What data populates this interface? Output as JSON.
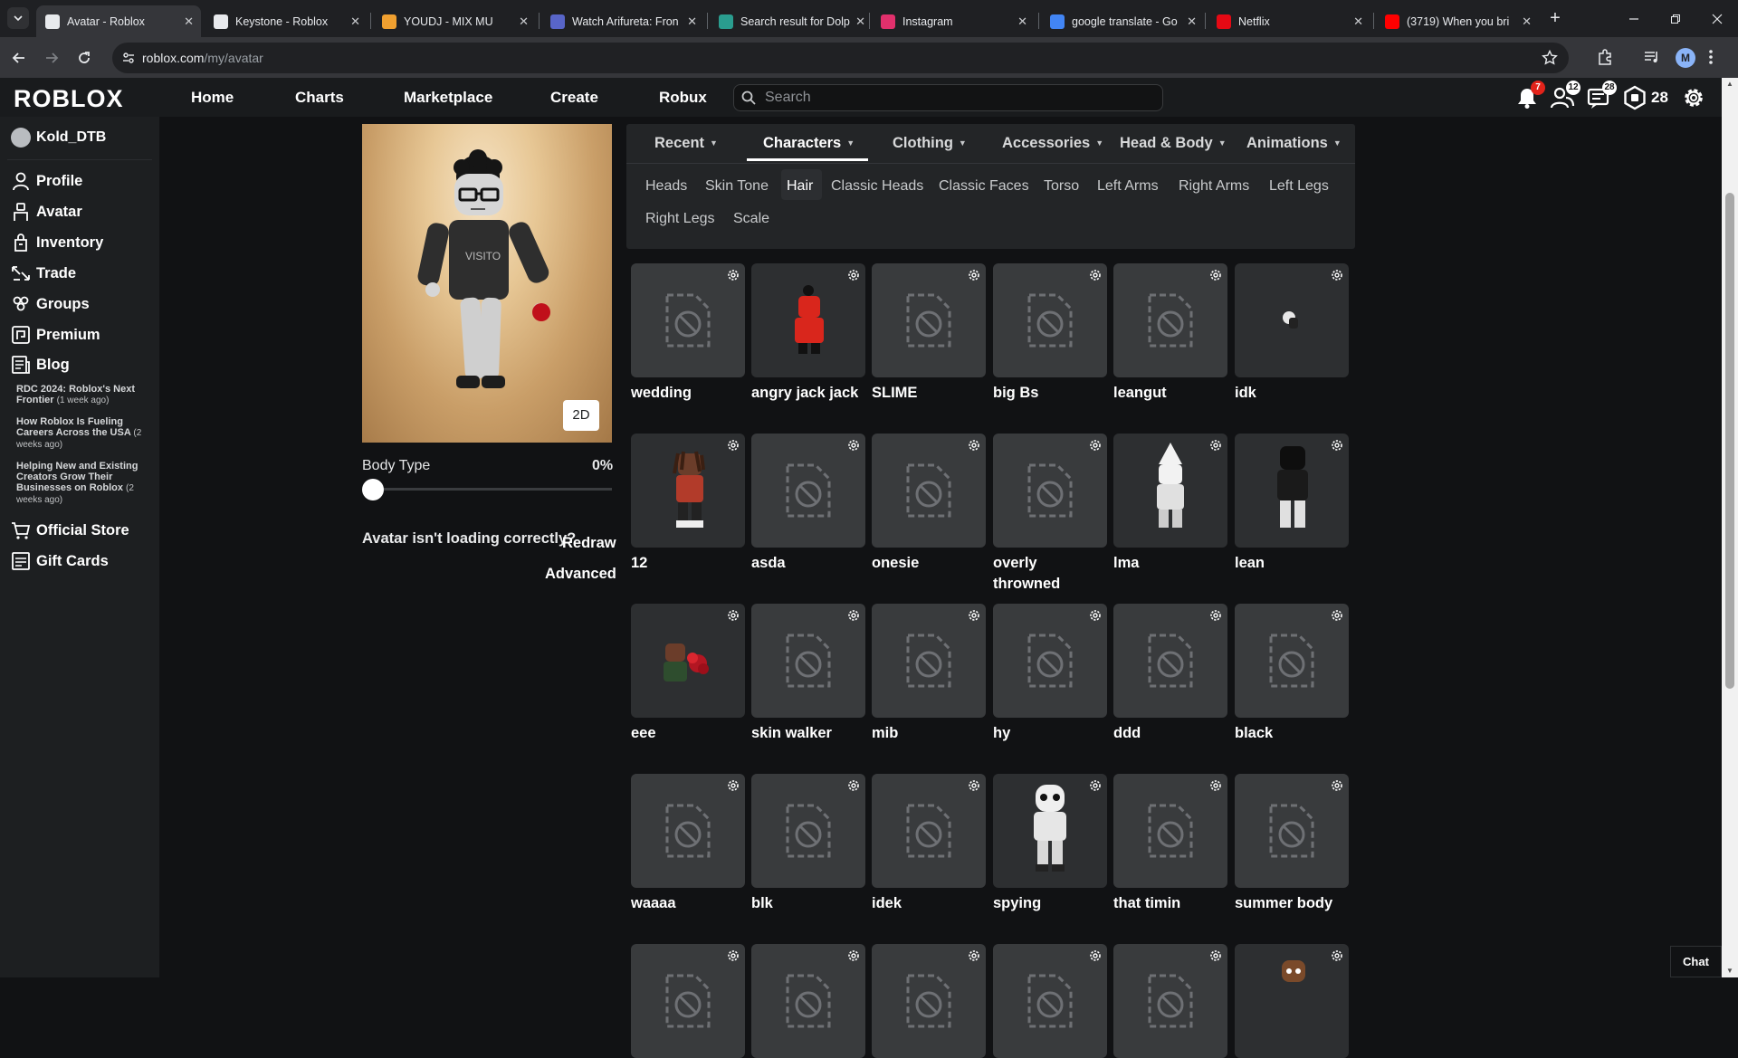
{
  "browser": {
    "tabs": [
      {
        "title": "Avatar - Roblox",
        "active": true,
        "favicon_color": "#e8eaed"
      },
      {
        "title": "Keystone - Roblox",
        "active": false,
        "favicon_color": "#e8eaed"
      },
      {
        "title": "YOUDJ - MIX MU",
        "active": false,
        "favicon_color": "#f0a030"
      },
      {
        "title": "Watch Arifureta: Fron",
        "active": false,
        "favicon_color": "#5865c8"
      },
      {
        "title": "Search result for Dolp",
        "active": false,
        "favicon_color": "#2a9d8f"
      },
      {
        "title": "Instagram",
        "active": false,
        "favicon_color": "#e1306c"
      },
      {
        "title": "google translate - Go",
        "active": false,
        "favicon_color": "#4285f4"
      },
      {
        "title": "Netflix",
        "active": false,
        "favicon_color": "#e50914"
      },
      {
        "title": "(3719) When you bri",
        "active": false,
        "favicon_color": "#ff0000"
      }
    ],
    "url_host": "roblox.com",
    "url_path": "/my/avatar",
    "profile_initial": "M"
  },
  "header": {
    "logo": "ROBLOX",
    "nav": [
      "Home",
      "Charts",
      "Marketplace",
      "Create",
      "Robux"
    ],
    "search_placeholder": "Search",
    "notifications_count": "7",
    "friends_count": "12",
    "messages_count": "28",
    "robux_balance": "28"
  },
  "sidebar": {
    "username": "Kold_DTB",
    "items": [
      {
        "label": "Profile",
        "icon": "profile-icon"
      },
      {
        "label": "Avatar",
        "icon": "avatar-icon"
      },
      {
        "label": "Inventory",
        "icon": "inventory-icon"
      },
      {
        "label": "Trade",
        "icon": "trade-icon"
      },
      {
        "label": "Groups",
        "icon": "groups-icon"
      },
      {
        "label": "Premium",
        "icon": "premium-icon"
      },
      {
        "label": "Blog",
        "icon": "blog-icon"
      }
    ],
    "blog_posts": [
      {
        "title": "RDC 2024: Roblox's Next Frontier",
        "when": "(1 week ago)"
      },
      {
        "title": "How Roblox Is Fueling Careers Across the USA",
        "when": "(2 weeks ago)"
      },
      {
        "title": "Helping New and Existing Creators Grow Their Businesses on Roblox",
        "when": "(2 weeks ago)"
      }
    ],
    "bottom_items": [
      {
        "label": "Official Store",
        "icon": "store-icon"
      },
      {
        "label": "Gift Cards",
        "icon": "gift-card-icon"
      }
    ]
  },
  "preview": {
    "toggle_label": "2D",
    "body_type_label": "Body Type",
    "body_type_value": "0%",
    "body_type_fraction": 0,
    "loading_message": "Avatar isn't loading correctly?",
    "redraw_label": "Redraw",
    "advanced_label": "Advanced"
  },
  "categories": {
    "tabs": [
      "Recent",
      "Characters",
      "Clothing",
      "Accessories",
      "Head & Body",
      "Animations"
    ],
    "active_tab": "Characters",
    "subtabs": [
      "Heads",
      "Skin Tone",
      "Hair",
      "Classic Heads",
      "Classic Faces",
      "Torso",
      "Left Arms",
      "Right Arms",
      "Left Legs",
      "Right Legs",
      "Scale"
    ],
    "active_subtab": "Hair"
  },
  "items": [
    {
      "name": "wedding",
      "thumb": "placeholder"
    },
    {
      "name": "angry jack jack",
      "thumb": "red-character"
    },
    {
      "name": "SLIME",
      "thumb": "placeholder"
    },
    {
      "name": "big Bs",
      "thumb": "placeholder"
    },
    {
      "name": "leangut",
      "thumb": "placeholder"
    },
    {
      "name": "idk",
      "thumb": "small-character"
    },
    {
      "name": "12",
      "thumb": "character-dreads"
    },
    {
      "name": "asda",
      "thumb": "placeholder"
    },
    {
      "name": "onesie",
      "thumb": "placeholder"
    },
    {
      "name": "overly throwned",
      "thumb": "placeholder"
    },
    {
      "name": "lma",
      "thumb": "white-hat-character"
    },
    {
      "name": "lean",
      "thumb": "dark-character"
    },
    {
      "name": "eee",
      "thumb": "character-roses"
    },
    {
      "name": "skin walker",
      "thumb": "placeholder"
    },
    {
      "name": "mib",
      "thumb": "placeholder"
    },
    {
      "name": "hy",
      "thumb": "placeholder"
    },
    {
      "name": "ddd",
      "thumb": "placeholder"
    },
    {
      "name": "black",
      "thumb": "placeholder"
    },
    {
      "name": "waaaa",
      "thumb": "placeholder"
    },
    {
      "name": "blk",
      "thumb": "placeholder"
    },
    {
      "name": "idek",
      "thumb": "placeholder"
    },
    {
      "name": "spying",
      "thumb": "mask-character"
    },
    {
      "name": "that timin",
      "thumb": "placeholder"
    },
    {
      "name": "summer body",
      "thumb": "placeholder"
    },
    {
      "name": "",
      "thumb": "placeholder"
    },
    {
      "name": "",
      "thumb": "placeholder"
    },
    {
      "name": "",
      "thumb": "placeholder"
    },
    {
      "name": "",
      "thumb": "placeholder"
    },
    {
      "name": "",
      "thumb": "placeholder"
    },
    {
      "name": "",
      "thumb": "brown-character"
    }
  ],
  "chat_label": "Chat",
  "colors": {
    "page_bg": "#111214",
    "panel_bg": "#232527",
    "card_bg": "#393b3d",
    "badge_red": "#e2231a",
    "badge_white": "#ffffff"
  }
}
